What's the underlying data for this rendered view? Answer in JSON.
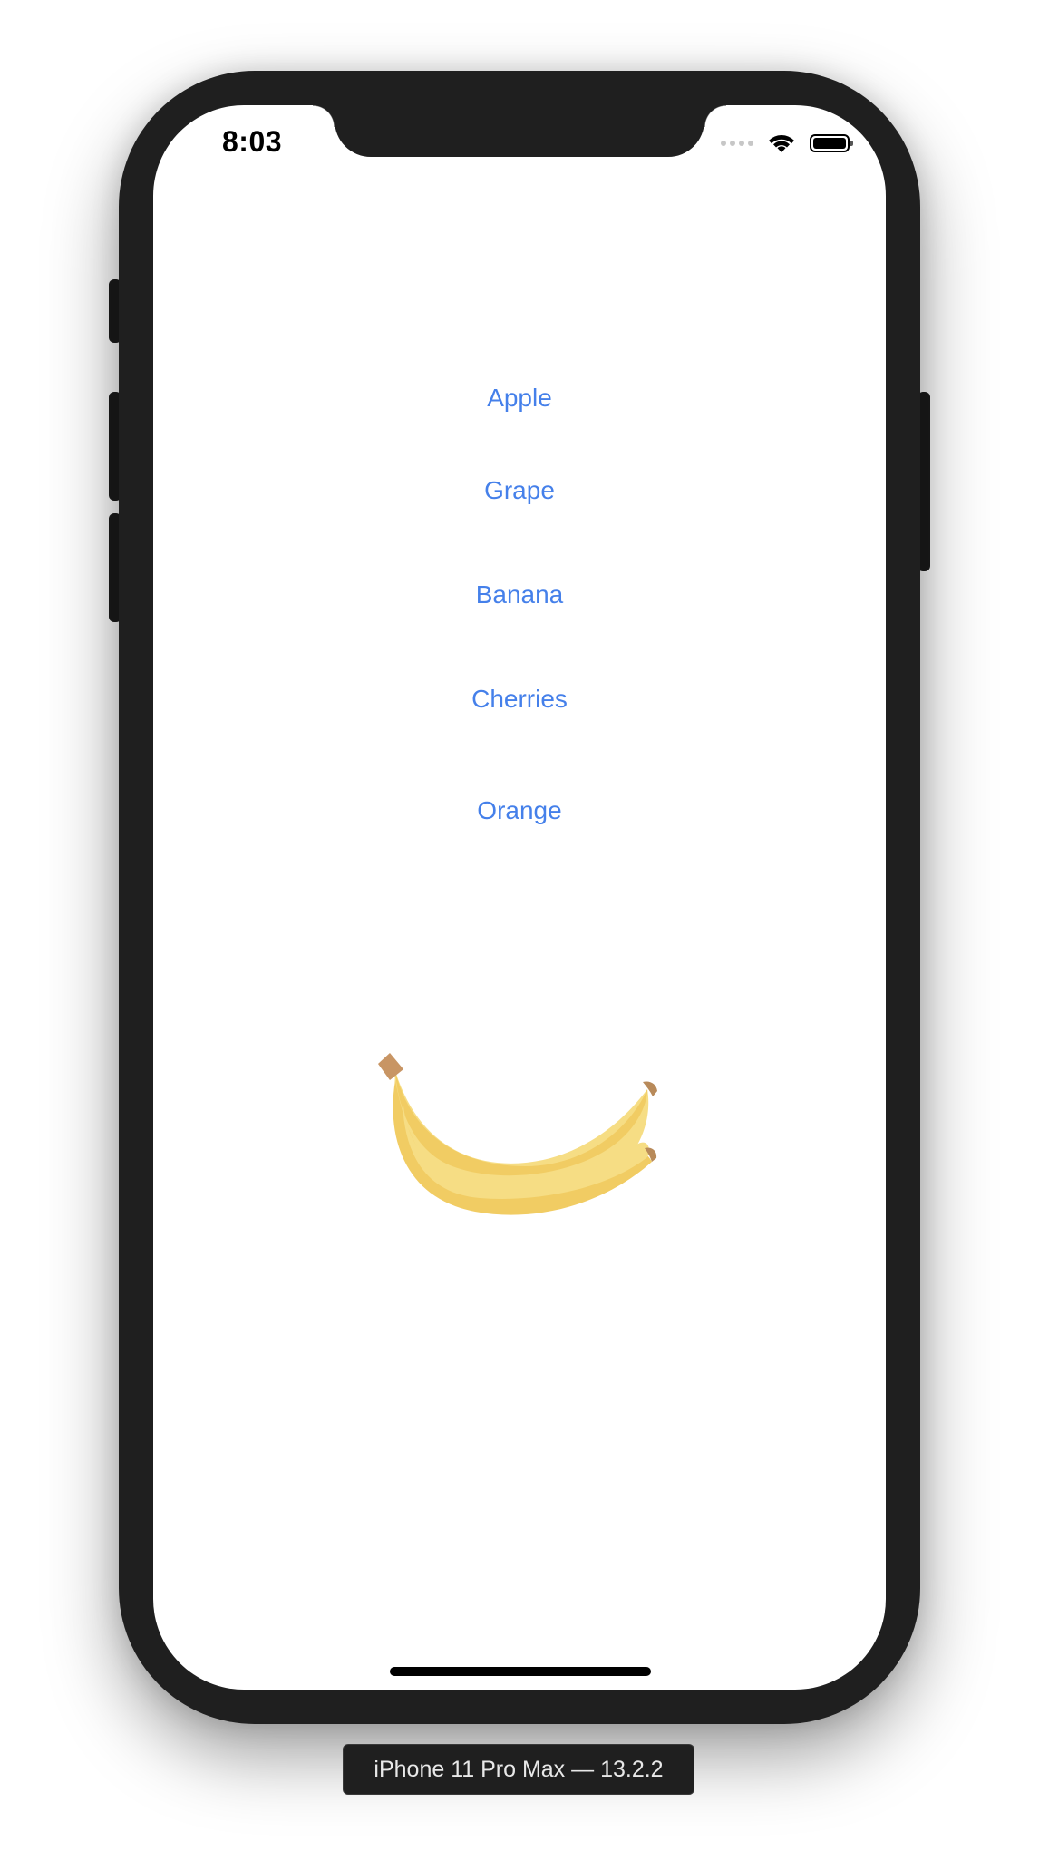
{
  "status_bar": {
    "time": "8:03",
    "wifi_icon": "wifi-icon",
    "battery_icon": "battery-icon",
    "cellular_icon": "cellular-signal-icon"
  },
  "fruits": [
    {
      "label": "Apple"
    },
    {
      "label": "Grape"
    },
    {
      "label": "Banana"
    },
    {
      "label": "Cherries"
    },
    {
      "label": "Orange"
    }
  ],
  "selected_fruit_image": "banana-icon",
  "simulator_label": "iPhone 11 Pro Max — 13.2.2",
  "colors": {
    "accent": "#4580ea",
    "banana_light": "#f6dd84",
    "banana_dark": "#f1cc63",
    "banana_stem": "#c89564",
    "device_frame": "#1f1f1f"
  }
}
